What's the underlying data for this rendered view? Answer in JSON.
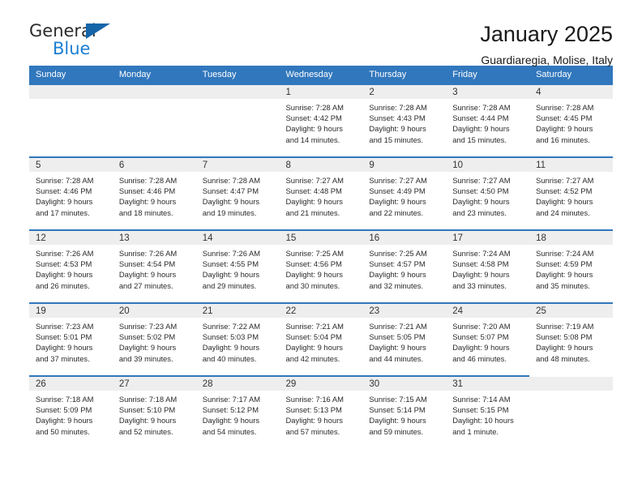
{
  "brand": {
    "name_top": "General",
    "name_bottom": "Blue",
    "triangle_icon": "triangle-logo-icon",
    "color_top": "#2b2b2b",
    "color_bottom": "#1b7fd4",
    "triangle_color": "#1565a8"
  },
  "header": {
    "title": "January 2025",
    "subtitle": "Guardiaregia, Molise, Italy"
  },
  "theme": {
    "header_bg": "#3177bd",
    "header_text": "#ffffff",
    "num_row_bg": "#eeeeee",
    "cell_bg": "#ffffff",
    "accent": "#3177bd"
  },
  "calendar": {
    "weekdays": [
      "Sunday",
      "Monday",
      "Tuesday",
      "Wednesday",
      "Thursday",
      "Friday",
      "Saturday"
    ],
    "weeks": [
      {
        "days": [
          {
            "num": "",
            "info": ""
          },
          {
            "num": "",
            "info": ""
          },
          {
            "num": "",
            "info": ""
          },
          {
            "num": "1",
            "info": "Sunrise: 7:28 AM\nSunset: 4:42 PM\nDaylight: 9 hours\nand 14 minutes."
          },
          {
            "num": "2",
            "info": "Sunrise: 7:28 AM\nSunset: 4:43 PM\nDaylight: 9 hours\nand 15 minutes."
          },
          {
            "num": "3",
            "info": "Sunrise: 7:28 AM\nSunset: 4:44 PM\nDaylight: 9 hours\nand 15 minutes."
          },
          {
            "num": "4",
            "info": "Sunrise: 7:28 AM\nSunset: 4:45 PM\nDaylight: 9 hours\nand 16 minutes."
          }
        ]
      },
      {
        "days": [
          {
            "num": "5",
            "info": "Sunrise: 7:28 AM\nSunset: 4:46 PM\nDaylight: 9 hours\nand 17 minutes."
          },
          {
            "num": "6",
            "info": "Sunrise: 7:28 AM\nSunset: 4:46 PM\nDaylight: 9 hours\nand 18 minutes."
          },
          {
            "num": "7",
            "info": "Sunrise: 7:28 AM\nSunset: 4:47 PM\nDaylight: 9 hours\nand 19 minutes."
          },
          {
            "num": "8",
            "info": "Sunrise: 7:27 AM\nSunset: 4:48 PM\nDaylight: 9 hours\nand 21 minutes."
          },
          {
            "num": "9",
            "info": "Sunrise: 7:27 AM\nSunset: 4:49 PM\nDaylight: 9 hours\nand 22 minutes."
          },
          {
            "num": "10",
            "info": "Sunrise: 7:27 AM\nSunset: 4:50 PM\nDaylight: 9 hours\nand 23 minutes."
          },
          {
            "num": "11",
            "info": "Sunrise: 7:27 AM\nSunset: 4:52 PM\nDaylight: 9 hours\nand 24 minutes."
          }
        ]
      },
      {
        "days": [
          {
            "num": "12",
            "info": "Sunrise: 7:26 AM\nSunset: 4:53 PM\nDaylight: 9 hours\nand 26 minutes."
          },
          {
            "num": "13",
            "info": "Sunrise: 7:26 AM\nSunset: 4:54 PM\nDaylight: 9 hours\nand 27 minutes."
          },
          {
            "num": "14",
            "info": "Sunrise: 7:26 AM\nSunset: 4:55 PM\nDaylight: 9 hours\nand 29 minutes."
          },
          {
            "num": "15",
            "info": "Sunrise: 7:25 AM\nSunset: 4:56 PM\nDaylight: 9 hours\nand 30 minutes."
          },
          {
            "num": "16",
            "info": "Sunrise: 7:25 AM\nSunset: 4:57 PM\nDaylight: 9 hours\nand 32 minutes."
          },
          {
            "num": "17",
            "info": "Sunrise: 7:24 AM\nSunset: 4:58 PM\nDaylight: 9 hours\nand 33 minutes."
          },
          {
            "num": "18",
            "info": "Sunrise: 7:24 AM\nSunset: 4:59 PM\nDaylight: 9 hours\nand 35 minutes."
          }
        ]
      },
      {
        "days": [
          {
            "num": "19",
            "info": "Sunrise: 7:23 AM\nSunset: 5:01 PM\nDaylight: 9 hours\nand 37 minutes."
          },
          {
            "num": "20",
            "info": "Sunrise: 7:23 AM\nSunset: 5:02 PM\nDaylight: 9 hours\nand 39 minutes."
          },
          {
            "num": "21",
            "info": "Sunrise: 7:22 AM\nSunset: 5:03 PM\nDaylight: 9 hours\nand 40 minutes."
          },
          {
            "num": "22",
            "info": "Sunrise: 7:21 AM\nSunset: 5:04 PM\nDaylight: 9 hours\nand 42 minutes."
          },
          {
            "num": "23",
            "info": "Sunrise: 7:21 AM\nSunset: 5:05 PM\nDaylight: 9 hours\nand 44 minutes."
          },
          {
            "num": "24",
            "info": "Sunrise: 7:20 AM\nSunset: 5:07 PM\nDaylight: 9 hours\nand 46 minutes."
          },
          {
            "num": "25",
            "info": "Sunrise: 7:19 AM\nSunset: 5:08 PM\nDaylight: 9 hours\nand 48 minutes."
          }
        ]
      },
      {
        "days": [
          {
            "num": "26",
            "info": "Sunrise: 7:18 AM\nSunset: 5:09 PM\nDaylight: 9 hours\nand 50 minutes."
          },
          {
            "num": "27",
            "info": "Sunrise: 7:18 AM\nSunset: 5:10 PM\nDaylight: 9 hours\nand 52 minutes."
          },
          {
            "num": "28",
            "info": "Sunrise: 7:17 AM\nSunset: 5:12 PM\nDaylight: 9 hours\nand 54 minutes."
          },
          {
            "num": "29",
            "info": "Sunrise: 7:16 AM\nSunset: 5:13 PM\nDaylight: 9 hours\nand 57 minutes."
          },
          {
            "num": "30",
            "info": "Sunrise: 7:15 AM\nSunset: 5:14 PM\nDaylight: 9 hours\nand 59 minutes."
          },
          {
            "num": "31",
            "info": "Sunrise: 7:14 AM\nSunset: 5:15 PM\nDaylight: 10 hours\nand 1 minute."
          },
          {
            "num": "",
            "info": ""
          }
        ]
      }
    ]
  }
}
